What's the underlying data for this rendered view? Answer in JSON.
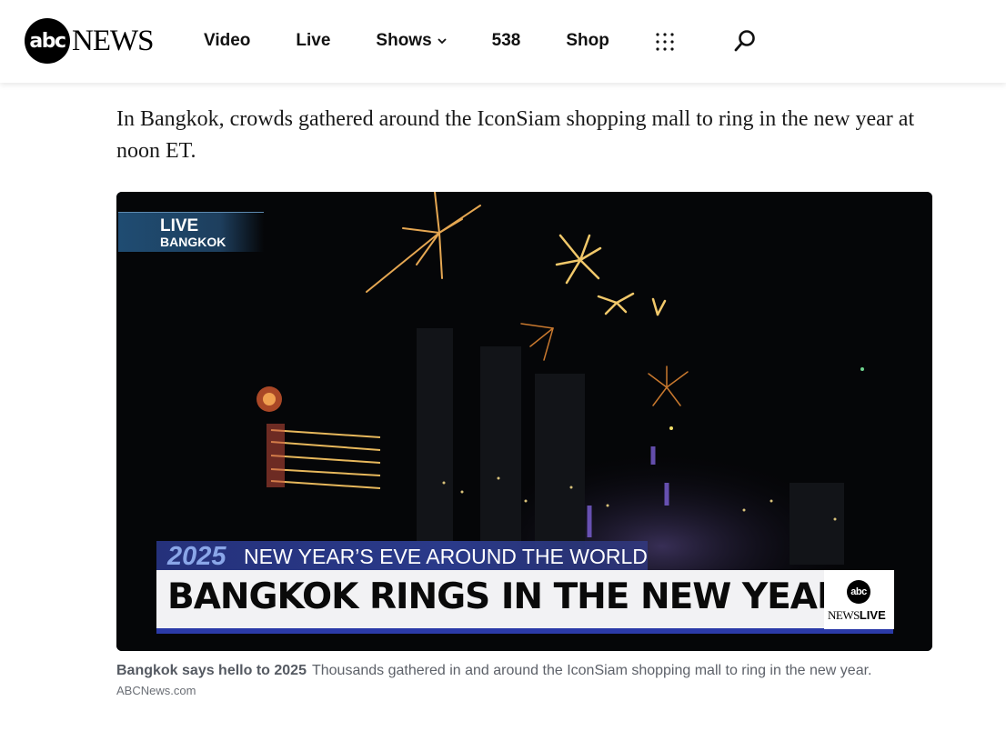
{
  "brand": {
    "logo_circle": "abc",
    "logo_word": "NEWS"
  },
  "nav": {
    "items": [
      {
        "label": "Video"
      },
      {
        "label": "Live"
      },
      {
        "label": "Shows"
      },
      {
        "label": "538"
      },
      {
        "label": "Shop"
      }
    ],
    "icons": [
      "chevron-down-icon",
      "more-grid-icon",
      "search-icon"
    ]
  },
  "article": {
    "lead_paragraph": "In Bangkok, crowds gathered around the IconSiam shopping mall to ring in the new year at noon ET."
  },
  "video": {
    "live_label": "LIVE",
    "location_label": "BANGKOK",
    "lower_third_year": "2025",
    "lower_third_subtitle": "NEW YEAR’S EVE AROUND THE WORLD",
    "headline": "BANGKOK RINGS IN THE NEW YEAR",
    "network_logo_circle": "abc",
    "network_logo_word_news": "NEWS",
    "network_logo_word_live": "LIVE",
    "colors": {
      "accent_blue": "#2b3aa8",
      "live_tag": "#1f4c72"
    }
  },
  "caption": {
    "title": "Bangkok says hello to 2025",
    "text": "Thousands gathered in and around the IconSiam shopping mall to ring in the new year.",
    "credit": "ABCNews.com"
  }
}
